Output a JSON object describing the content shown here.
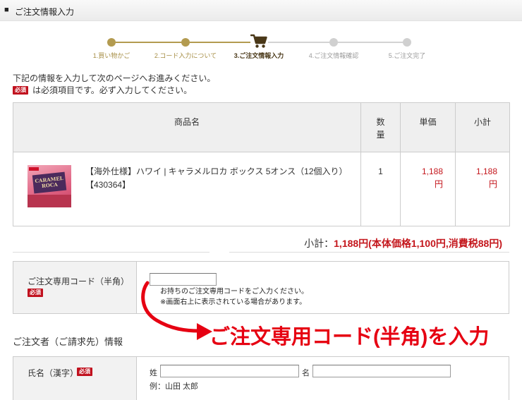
{
  "header": {
    "bullet": "■",
    "title": "ご注文情報入力"
  },
  "steps": [
    {
      "label": "1.買い物かご",
      "state": "done"
    },
    {
      "label": "2.コード入力について",
      "state": "done"
    },
    {
      "label": "3.ご注文情報入力",
      "state": "current",
      "icon": "cart-icon"
    },
    {
      "label": "4.ご注文情報確認",
      "state": "todo"
    },
    {
      "label": "5.ご注文完了",
      "state": "todo"
    }
  ],
  "intro": {
    "line1": "下記の情報を入力して次のページへお進みください。",
    "required_badge": "必須",
    "line2": "は必須項目です。必ず入力してください。"
  },
  "cart_table": {
    "headers": {
      "name": "商品名",
      "qty": "数量",
      "unit_price": "単価",
      "subtotal": "小計"
    },
    "rows": [
      {
        "image_label": "CARAMEL ROCA",
        "name": "【海外仕様】ハワイ | キャラメルロカ ボックス 5オンス（12個入り）",
        "code": "【430364】",
        "qty": "1",
        "unit_price": "1,188",
        "unit_price_unit": "円",
        "subtotal": "1,188",
        "subtotal_unit": "円"
      }
    ]
  },
  "summary": {
    "label": "小計：",
    "value": "1,188円(本体価格1,100円,消費税88円)"
  },
  "order_code": {
    "label": "ご注文専用コード（半角）",
    "required_badge": "必須",
    "value": "",
    "help_line1": "お持ちのご注文専用コードをご入力ください。",
    "help_line2": "※画面右上に表示されている場合があります。"
  },
  "annotation": {
    "text": "ご注文専用コード(半角)を入力"
  },
  "customer_section": {
    "heading": "ご注文者（ご請求先）情報",
    "name_field": {
      "label": "氏名（漢字）",
      "required_badge": "必須",
      "last_name_label": "姓",
      "last_name_value": "",
      "first_name_label": "名",
      "first_name_value": "",
      "example": "例：山田 太郎"
    }
  },
  "colors": {
    "step_done": "#b39b50",
    "step_current": "#4a3818",
    "step_todo": "#d0d0d0",
    "price_red": "#c4161c",
    "badge_red": "#c1121f",
    "annotation_red": "#e60012"
  }
}
